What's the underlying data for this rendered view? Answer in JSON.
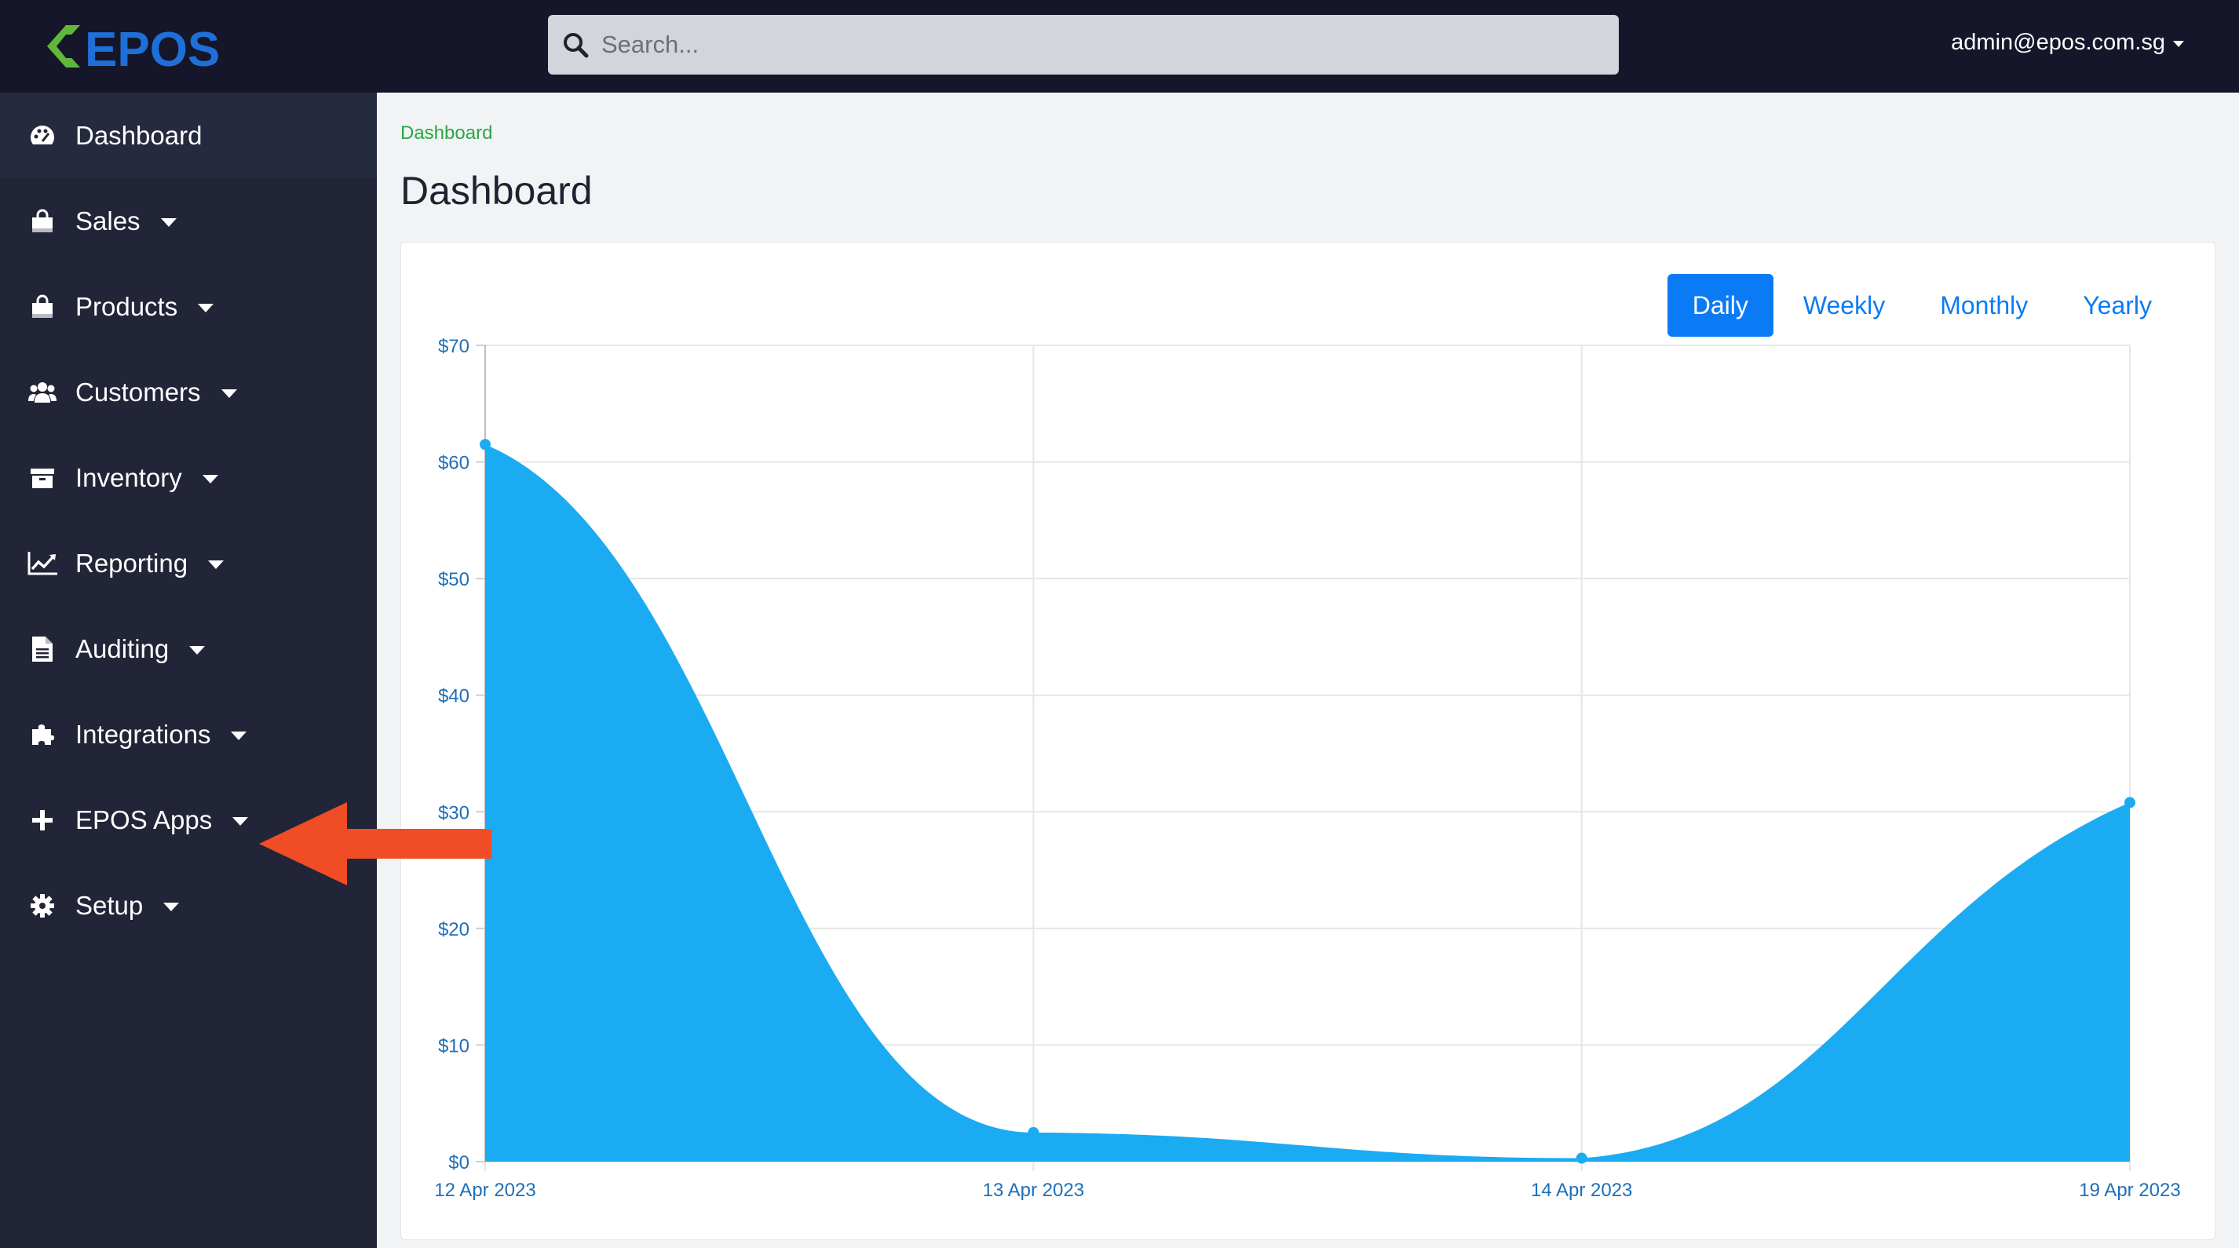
{
  "header": {
    "brand": "EPOS",
    "search_placeholder": "Search...",
    "user_email": "admin@epos.com.sg"
  },
  "colors": {
    "topbar": "#15162a",
    "sidebar": "#222437",
    "accent_blue": "#0b7bf5",
    "chart_fill": "#1aabf3",
    "brand_green": "#5fb83b",
    "brand_blue": "#1f6fd8",
    "annotation_red": "#f04d27"
  },
  "sidebar": {
    "items": [
      {
        "label": "Dashboard",
        "icon": "palette-icon",
        "has_caret": false
      },
      {
        "label": "Sales",
        "icon": "shopping-bag-icon",
        "has_caret": true
      },
      {
        "label": "Products",
        "icon": "shopping-bag-icon",
        "has_caret": true
      },
      {
        "label": "Customers",
        "icon": "users-icon",
        "has_caret": true
      },
      {
        "label": "Inventory",
        "icon": "archive-box-icon",
        "has_caret": true
      },
      {
        "label": "Reporting",
        "icon": "line-chart-icon",
        "has_caret": true
      },
      {
        "label": "Auditing",
        "icon": "document-icon",
        "has_caret": true
      },
      {
        "label": "Integrations",
        "icon": "puzzle-icon",
        "has_caret": true
      },
      {
        "label": "EPOS Apps",
        "icon": "plus-icon",
        "has_caret": true
      },
      {
        "label": "Setup",
        "icon": "gear-icon",
        "has_caret": true
      }
    ]
  },
  "main": {
    "breadcrumb": "Dashboard",
    "title": "Dashboard",
    "periods": [
      {
        "label": "Daily",
        "active": true
      },
      {
        "label": "Weekly",
        "active": false
      },
      {
        "label": "Monthly",
        "active": false
      },
      {
        "label": "Yearly",
        "active": false
      }
    ]
  },
  "chart_data": {
    "type": "area",
    "categories": [
      "12 Apr 2023",
      "13 Apr 2023",
      "14 Apr 2023",
      "19 Apr 2023"
    ],
    "series": [
      {
        "values": [
          61.5,
          2.5,
          0.3,
          30.8
        ]
      }
    ],
    "title": "",
    "xlabel": "",
    "ylabel": "",
    "ylim": [
      0,
      70
    ],
    "yticks": [
      0,
      10,
      20,
      30,
      40,
      50,
      60,
      70
    ],
    "ytick_labels": [
      "$0",
      "$10",
      "$20",
      "$30",
      "$40",
      "$50",
      "$60",
      "$70"
    ],
    "grid": true,
    "legend": "none"
  }
}
